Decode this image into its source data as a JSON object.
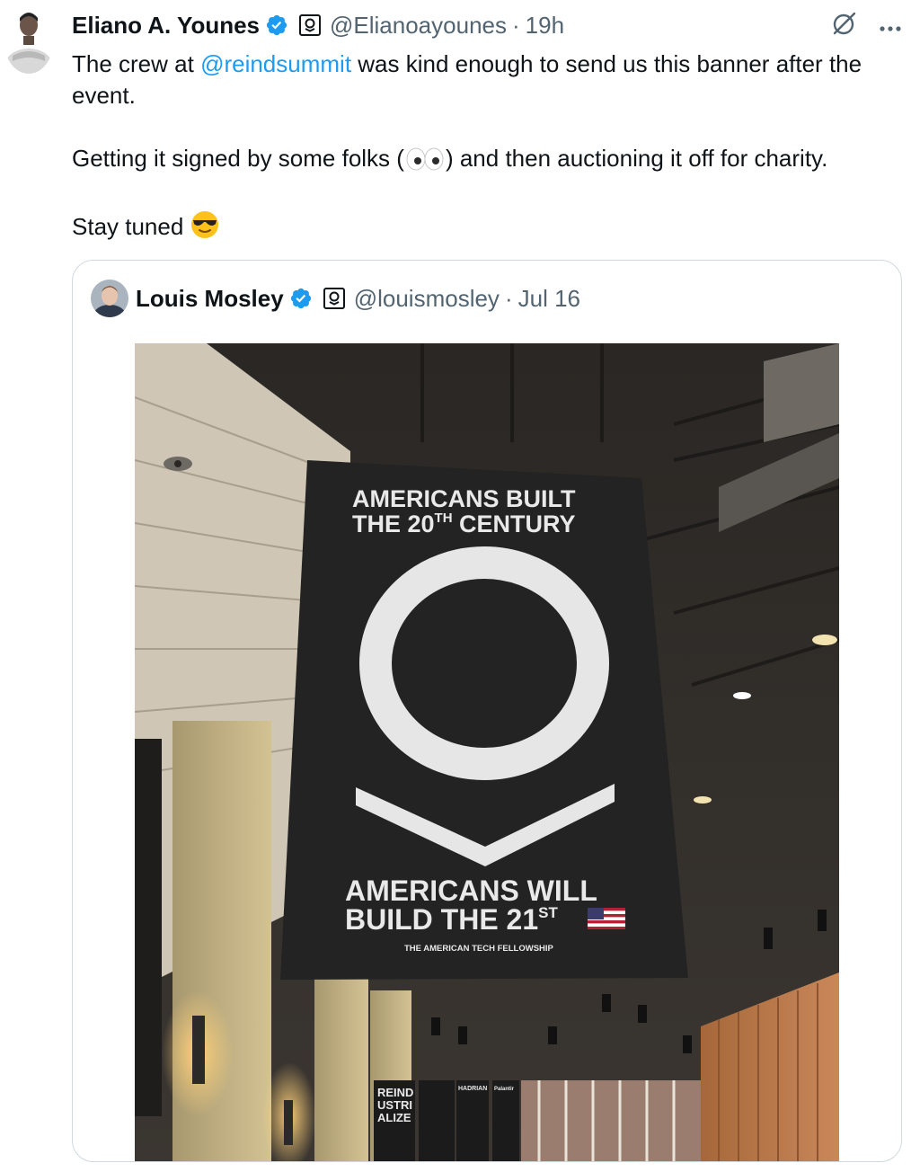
{
  "tweet": {
    "author_name": "Eliano A. Younes",
    "author_handle": "@Elianoayounes",
    "separator": "·",
    "time": "19h",
    "line1_before": "The crew at ",
    "line1_mention": "@reindsummit",
    "line1_after": " was kind enough to send us this banner after the event.",
    "line2_before": "Getting it signed by some folks (",
    "line2_emoji": "eyes-emoji",
    "line2_after": ") and then auctioning it off for charity.",
    "line3": "Stay tuned",
    "line3_emoji": "sunglasses-emoji"
  },
  "quoted_tweet": {
    "author_name": "Louis Mosley",
    "author_handle": "@louismosley",
    "separator": "·",
    "date": "Jul 16",
    "banner": {
      "top_line1": "AMERICANS BUILT",
      "top_line2_a": "THE 20",
      "top_line2_sup": "TH",
      "top_line2_b": " CENTURY",
      "bottom_line1": "AMERICANS WILL",
      "bottom_line2_a": "BUILD THE 21",
      "bottom_line2_sup": "ST",
      "tagline": "THE AMERICAN TECH FELLOWSHIP",
      "sign_left": [
        "REIND",
        "USTRI",
        "ALIZE"
      ],
      "sign_mid": "HADRIAN",
      "sign_right": "Palantir"
    }
  },
  "icons": {
    "verified": "verified-badge-icon",
    "affiliation": "palantir-affiliation-icon",
    "grok": "grok-icon",
    "more": "more-options-icon"
  },
  "colors": {
    "link": "#1d9bf0",
    "secondary_text": "#536471",
    "border": "#cfd9de",
    "verified": "#1d9bf0"
  }
}
